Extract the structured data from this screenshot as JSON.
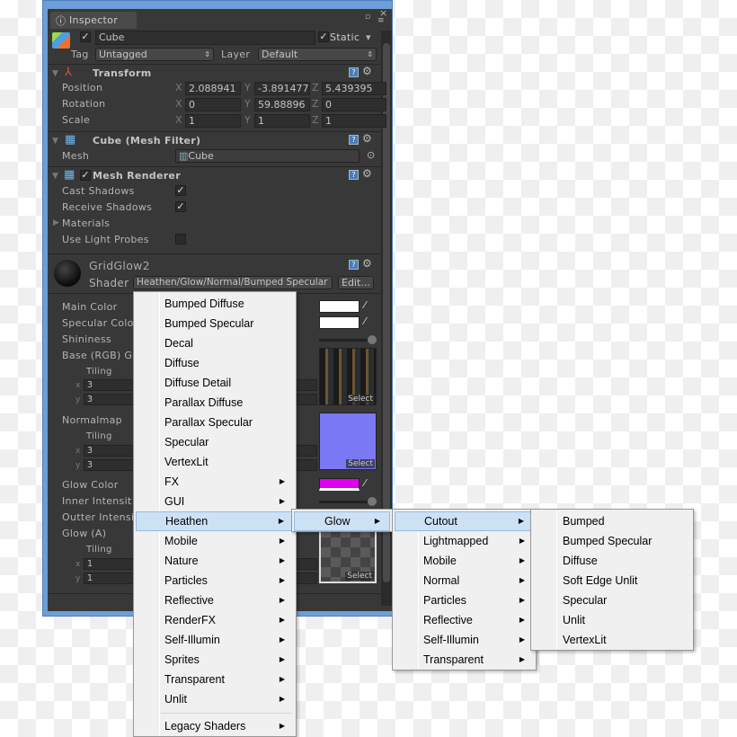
{
  "window": {
    "tab": "Inspector"
  },
  "object": {
    "name": "Cube",
    "active": true,
    "static_label": "Static",
    "static": true,
    "tag_label": "Tag",
    "tag": "Untagged",
    "layer_label": "Layer",
    "layer": "Default"
  },
  "transform": {
    "title": "Transform",
    "rows": [
      {
        "label": "Position",
        "x": "2.088941",
        "y": "-3.891477",
        "z": "5.439395"
      },
      {
        "label": "Rotation",
        "x": "0",
        "y": "59.88896",
        "z": "0"
      },
      {
        "label": "Scale",
        "x": "1",
        "y": "1",
        "z": "1"
      }
    ]
  },
  "axes": {
    "x": "X",
    "y": "Y",
    "z": "Z"
  },
  "mesh_filter": {
    "title": "Cube (Mesh Filter)",
    "mesh_label": "Mesh",
    "mesh": "Cube"
  },
  "mesh_renderer": {
    "title": "Mesh Renderer",
    "cast": "Cast Shadows",
    "cast_on": true,
    "receive": "Receive Shadows",
    "receive_on": true,
    "materials": "Materials",
    "probes": "Use Light Probes",
    "probes_on": false
  },
  "material": {
    "name": "GridGlow2",
    "shader_label": "Shader",
    "shader": "Heathen/Glow/Normal/Bumped Specular",
    "edit": "Edit...",
    "props": {
      "main_color": "Main Color",
      "spec_color": "Specular Colo",
      "shininess": "Shininess",
      "base": "Base (RGB) G",
      "normalmap": "Normalmap",
      "glow_color": "Glow Color",
      "inner": "Inner Intensit",
      "outter": "Outter Intensi",
      "glow_a": "Glow (A)",
      "tiling": "Tiling",
      "x": "x",
      "y": "y",
      "select": "Select"
    },
    "tiling": {
      "base": [
        "3",
        "3"
      ],
      "normal": [
        "3",
        "3"
      ],
      "glow": [
        "1",
        "1"
      ]
    },
    "colors": {
      "main": "#ffffff",
      "specular": "#ffffff",
      "glow": "#e000f0"
    }
  },
  "menus": {
    "main": {
      "items": [
        "Bumped Diffuse",
        "Bumped Specular",
        "Decal",
        "Diffuse",
        "Diffuse Detail",
        "Parallax Diffuse",
        "Parallax Specular",
        "Specular",
        "VertexLit",
        "FX",
        "GUI",
        "Heathen",
        "Mobile",
        "Nature",
        "Particles",
        "Reflective",
        "RenderFX",
        "Self-Illumin",
        "Sprites",
        "Transparent",
        "Unlit"
      ],
      "submenu_from": 9,
      "highlight": 11,
      "legacy": "Legacy Shaders"
    },
    "heathen": {
      "items": [
        "Glow"
      ],
      "submenu_from": 0,
      "highlight": 0
    },
    "glow": {
      "items": [
        "Cutout",
        "Lightmapped",
        "Mobile",
        "Normal",
        "Particles",
        "Reflective",
        "Self-Illumin",
        "Transparent"
      ],
      "submenu_from": 0,
      "highlight": 0
    },
    "cutout": {
      "items": [
        "Bumped",
        "Bumped Specular",
        "Diffuse",
        "Soft Edge Unlit",
        "Specular",
        "Unlit",
        "VertexLit"
      ],
      "submenu_from": 99,
      "highlight": -1
    }
  }
}
